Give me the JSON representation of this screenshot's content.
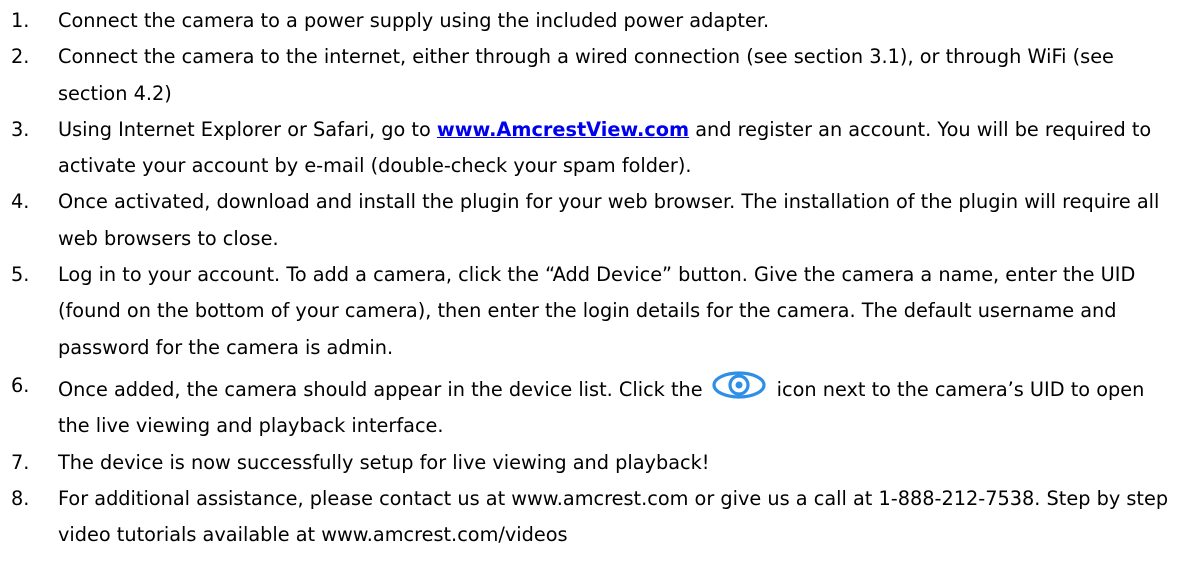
{
  "steps": [
    {
      "number": "1.",
      "text": "Connect the camera to a power supply using the included power adapter."
    },
    {
      "number": "2.",
      "text": "Connect the camera to the internet, either through a wired connection (see section 3.1), or through WiFi (see section 4.2)"
    },
    {
      "number": "3.",
      "before": "Using Internet Explorer or Safari, go to ",
      "link": "www.AmcrestView.com",
      "after": " and register an account. You will be required to activate your account by e-mail (double-check your spam folder)."
    },
    {
      "number": "4.",
      "text": "Once activated, download and install the plugin for your web browser. The installation of the plugin will require all web browsers to close."
    },
    {
      "number": "5.",
      "text": "Log in to your account. To add a camera, click the “Add Device” button. Give the camera a name, enter the UID (found on the bottom of your camera), then enter the login details for the camera. The default username and password for the camera is admin."
    },
    {
      "number": "6.",
      "before": "Once added, the camera should appear in the device list. Click the",
      "icon": "eye-icon",
      "after": "icon next to the camera’s UID to open the live viewing and playback interface."
    },
    {
      "number": "7.",
      "text": "The device is now successfully setup for live viewing and playback!"
    },
    {
      "number": "8.",
      "text": "For additional assistance, please contact us at www.amcrest.com or give us a call at 1-888-212-7538. Step by step video tutorials available at www.amcrest.com/videos"
    }
  ],
  "colors": {
    "link": "#0000ee",
    "eye_icon": "#2f8fe6"
  }
}
